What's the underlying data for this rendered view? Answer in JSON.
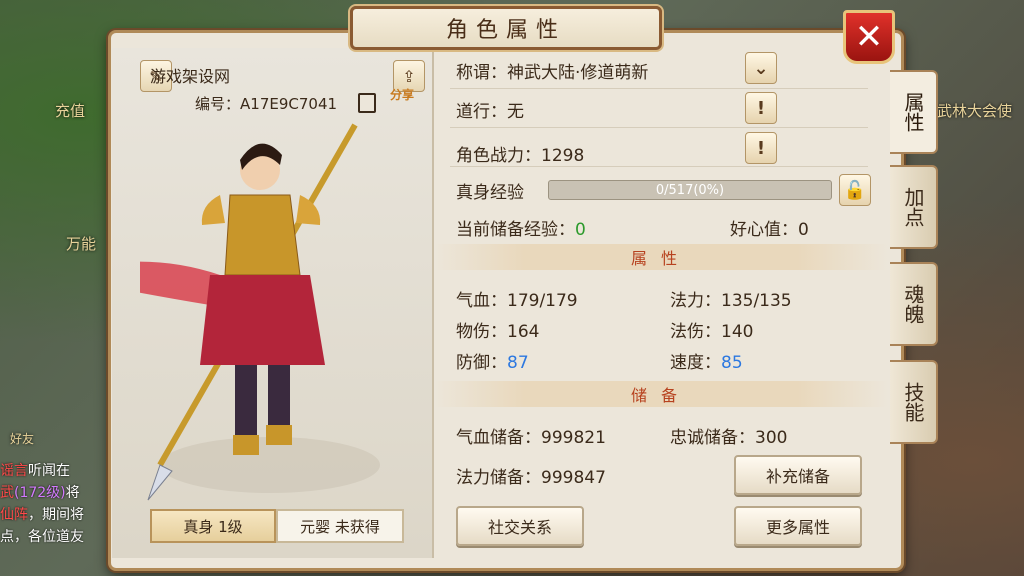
{
  "window": {
    "title": "角色属性",
    "close_label": "✕"
  },
  "background": {
    "left_label_1": "充值",
    "left_label_2": "万能",
    "right_label": "武林大会使",
    "friend_label": "好友"
  },
  "chat": {
    "line1_tag": "谣言",
    "line1_text": "听闻在",
    "line2_a": "武",
    "line2_b": "(172级)",
    "line2_c": "将",
    "line3_a": "仙阵",
    "line3_b": "，期间将",
    "line4": "点，各位道友"
  },
  "character": {
    "name": "游戏架设网",
    "id_label": "编号：",
    "id_value": "A17E9C7041",
    "share_label": "分享",
    "tab_true_body": "真身 1级",
    "tab_yuanying": "元婴 未获得"
  },
  "info": {
    "title_label": "称谓：",
    "title_value": "神武大陆·修道萌新",
    "daoxing_label": "道行：",
    "daoxing_value": "无",
    "power_label": "角色战力：",
    "power_value": "1298",
    "exp_label": "真身经验",
    "exp_text": "0/517(0%)",
    "exp_progress": 0,
    "stored_exp_label": "当前储备经验：",
    "stored_exp_value": "0",
    "kindness_label": "好心值：",
    "kindness_value": "0"
  },
  "attributes": {
    "section_title": "属性",
    "hp_label": "气血：",
    "hp_value": "179/179",
    "mp_label": "法力：",
    "mp_value": "135/135",
    "patk_label": "物伤：",
    "patk_value": "164",
    "matk_label": "法伤：",
    "matk_value": "140",
    "def_label": "防御：",
    "def_value": "87",
    "spd_label": "速度：",
    "spd_value": "85"
  },
  "reserves": {
    "section_title": "储备",
    "hp_res_label": "气血储备：",
    "hp_res_value": "999821",
    "loyalty_label": "忠诚储备：",
    "loyalty_value": "300",
    "mp_res_label": "法力储备：",
    "mp_res_value": "999847",
    "refill_button": "补充储备"
  },
  "buttons": {
    "social": "社交关系",
    "more_attrs": "更多属性"
  },
  "side_tabs": [
    {
      "label": "属性",
      "active": true
    },
    {
      "label": "加点",
      "active": false
    },
    {
      "label": "魂魄",
      "active": false
    },
    {
      "label": "技能",
      "active": false
    }
  ],
  "colors": {
    "accent_red": "#b7421f",
    "value_green": "#2c9a2c",
    "value_blue": "#2c78e0",
    "frame": "#b08a58"
  }
}
